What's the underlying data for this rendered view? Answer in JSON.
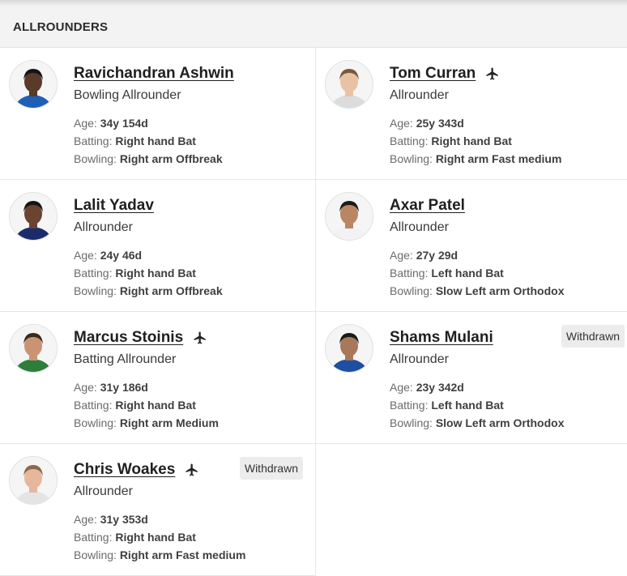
{
  "section": {
    "title": "ALLROUNDERS"
  },
  "labels": {
    "age": "Age: ",
    "batting": "Batting: ",
    "bowling": "Bowling: "
  },
  "players": [
    {
      "name": "Ravichandran Ashwin",
      "role": "Bowling Allrounder",
      "age": "34y 154d",
      "batting": "Right hand Bat",
      "bowling": "Right arm Offbreak",
      "overseas": false,
      "badge": "",
      "skin": "#5a3a28",
      "hair": "#141414",
      "jersey": "#1f5fb5"
    },
    {
      "name": "Tom Curran",
      "role": "Allrounder",
      "age": "25y 343d",
      "batting": "Right hand Bat",
      "bowling": "Right arm Fast medium",
      "overseas": true,
      "badge": "",
      "skin": "#e9c2a6",
      "hair": "#7a5a3c",
      "jersey": "#dcdcdc"
    },
    {
      "name": "Lalit Yadav",
      "role": "Allrounder",
      "age": "24y 46d",
      "batting": "Right hand Bat",
      "bowling": "Right arm Offbreak",
      "overseas": false,
      "badge": "",
      "skin": "#6b4330",
      "hair": "#151515",
      "jersey": "#1c2c6b"
    },
    {
      "name": "Axar Patel",
      "role": "Allrounder",
      "age": "27y 29d",
      "batting": "Left hand Bat",
      "bowling": "Slow Left arm Orthodox",
      "overseas": false,
      "badge": "",
      "skin": "#b98563",
      "hair": "#1b1b1b",
      "jersey": "#f2f2f2"
    },
    {
      "name": "Marcus Stoinis",
      "role": "Batting Allrounder",
      "age": "31y 186d",
      "batting": "Right hand Bat",
      "bowling": "Right arm Medium",
      "overseas": true,
      "badge": "",
      "skin": "#c99474",
      "hair": "#3a2a1e",
      "jersey": "#2f7d3a"
    },
    {
      "name": "Shams Mulani",
      "role": "Allrounder",
      "age": "23y 342d",
      "batting": "Left hand Bat",
      "bowling": "Slow Left arm Orthodox",
      "overseas": false,
      "badge": "Withdrawn",
      "skin": "#a9785a",
      "hair": "#1a1a1a",
      "jersey": "#1f4fa0"
    },
    {
      "name": "Chris Woakes",
      "role": "Allrounder",
      "age": "31y 353d",
      "batting": "Right hand Bat",
      "bowling": "Right arm Fast medium",
      "overseas": true,
      "badge": "Withdrawn",
      "skin": "#e6b79c",
      "hair": "#8a6a4a",
      "jersey": "#e4e4e4"
    }
  ]
}
